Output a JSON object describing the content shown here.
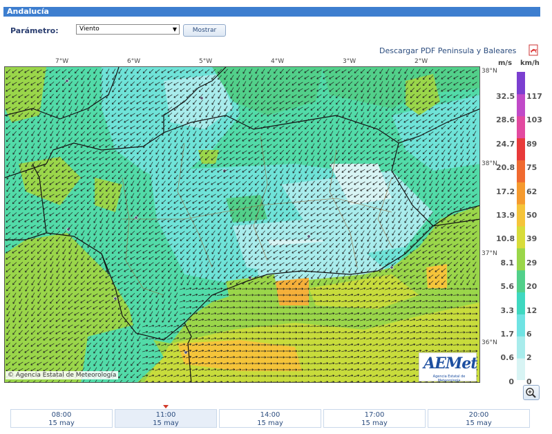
{
  "header": {
    "title": "Andalucía"
  },
  "controls": {
    "parameter_label": "Parámetro:",
    "parameter_value": "Viento",
    "show_button": "Mostrar",
    "pdf_link": "Descargar PDF Peninsula y Baleares"
  },
  "map": {
    "longitude_labels": [
      "7°W",
      "6°W",
      "5°W",
      "4°W",
      "3°W",
      "2°W"
    ],
    "latitude_labels": [
      "38°N",
      "38°N",
      "37°N",
      "36°N"
    ],
    "copyright": "© Agencia Estatal de Meteorología",
    "logo_text": "AEMet",
    "logo_subtext": "Agencia Estatal de Meteorología"
  },
  "legend": {
    "unit_ms": "m/s",
    "unit_kmh": "km/h",
    "ms_values": [
      "32.5",
      "28.6",
      "24.7",
      "20.8",
      "17.2",
      "13.9",
      "10.8",
      "8.1",
      "5.6",
      "3.3",
      "1.7",
      "0.6",
      "0"
    ],
    "kmh_values": [
      "117",
      "103",
      "89",
      "75",
      "62",
      "50",
      "39",
      "29",
      "20",
      "12",
      "6",
      "2",
      "0"
    ],
    "colors": [
      "#d8f4f4",
      "#a8ecec",
      "#6fe3e3",
      "#3fd8c0",
      "#52d08a",
      "#9ad64a",
      "#d8dc3a",
      "#f5c43a",
      "#f59a2e",
      "#f06a30",
      "#e83a3a",
      "#e24aa0",
      "#c04ac8",
      "#7b3fd0"
    ]
  },
  "timeline": {
    "times": [
      {
        "time": "08:00",
        "date": "15 may"
      },
      {
        "time": "11:00",
        "date": "15 may"
      },
      {
        "time": "14:00",
        "date": "15 may"
      },
      {
        "time": "17:00",
        "date": "15 may"
      },
      {
        "time": "20:00",
        "date": "15 may"
      }
    ],
    "active_index": 1
  }
}
